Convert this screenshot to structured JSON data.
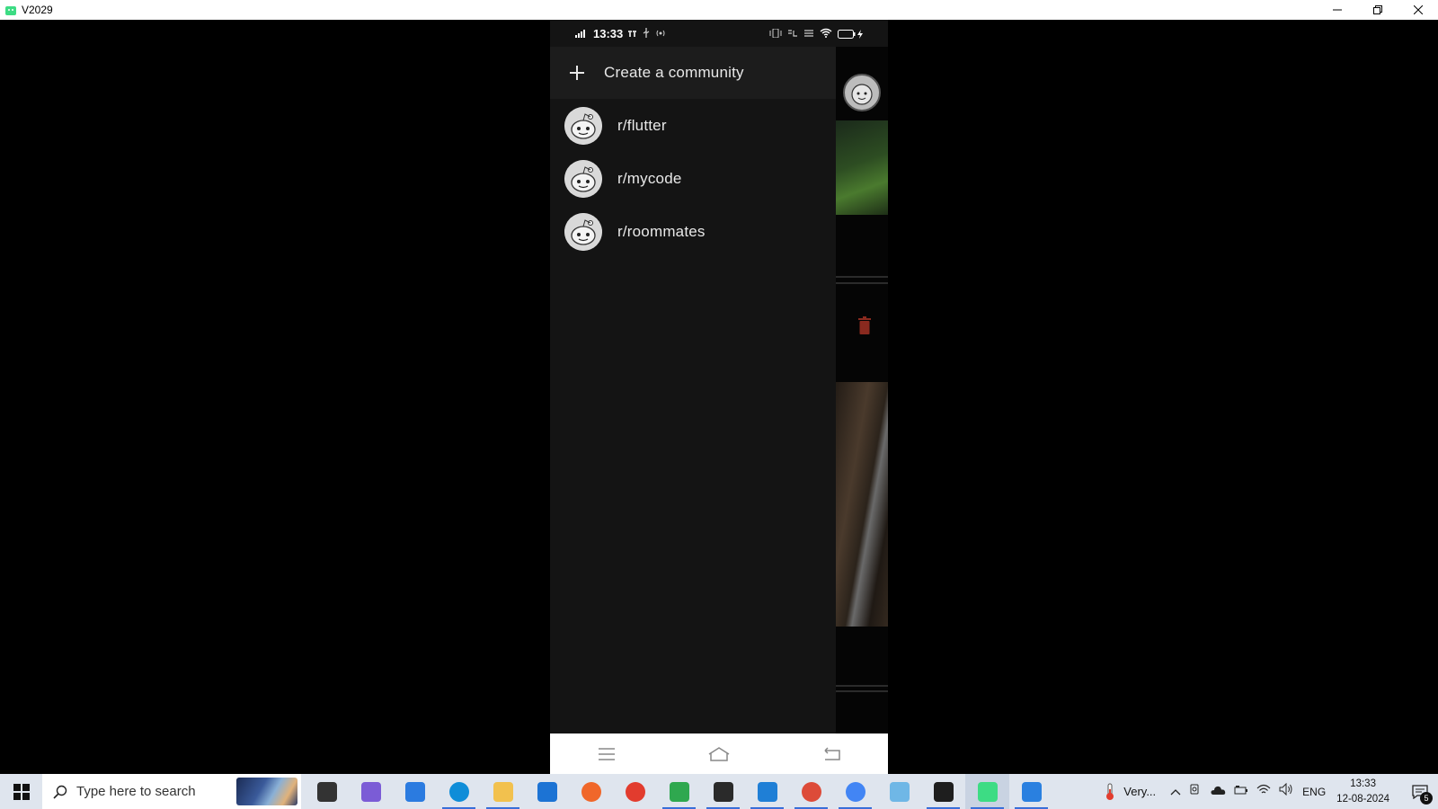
{
  "window": {
    "title": "V2029",
    "controls": [
      "minimize-icon",
      "restore-icon",
      "close-icon"
    ]
  },
  "phone": {
    "status_bar": {
      "time": "13:33",
      "left_icons": [
        "signal-icon",
        "network-icon",
        "usb-icon",
        "hotspot-icon"
      ],
      "right_icons": [
        "vibrate-icon",
        "volte-icon",
        "data-speed-icon",
        "wifi-icon",
        "battery-icon"
      ],
      "battery_level": "7"
    },
    "drawer": {
      "create_label": "Create a community",
      "communities": [
        {
          "label": "r/flutter"
        },
        {
          "label": "r/mycode"
        },
        {
          "label": "r/roommates"
        }
      ]
    },
    "nav_bar": [
      "menu-icon",
      "home-icon",
      "back-icon"
    ]
  },
  "taskbar": {
    "search_placeholder": "Type here to search",
    "apps": [
      {
        "name": "task-view-icon",
        "color": "#333333"
      },
      {
        "name": "copilot-icon",
        "color": "#7b5cd6"
      },
      {
        "name": "microsoft-store-icon",
        "color": "#2b7be0"
      },
      {
        "name": "edge-icon",
        "color": "#0f8dd8"
      },
      {
        "name": "file-explorer-icon",
        "color": "#f2c14e"
      },
      {
        "name": "mail-icon",
        "color": "#1c73d4"
      },
      {
        "name": "firefox-icon",
        "color": "#f0672a"
      },
      {
        "name": "wps-office-icon",
        "color": "#e23c2e"
      },
      {
        "name": "chat-app-icon",
        "color": "#2fa84f"
      },
      {
        "name": "settings-icon",
        "color": "#2a2a2a"
      },
      {
        "name": "vscode-icon",
        "color": "#1f7fd6"
      },
      {
        "name": "chrome-icon",
        "color": "#dd4b39"
      },
      {
        "name": "chrome-profile-icon",
        "color": "#4285f4"
      },
      {
        "name": "notepad-icon",
        "color": "#6fb7e6"
      },
      {
        "name": "terminal-icon",
        "color": "#1e1e1e"
      },
      {
        "name": "android-emulator-icon",
        "color": "#3ddc84"
      },
      {
        "name": "photos-icon",
        "color": "#2a80e0"
      }
    ],
    "weather_text": "Very...",
    "language": "ENG",
    "time": "13:33",
    "date": "12-08-2024",
    "notification_count": "5"
  }
}
